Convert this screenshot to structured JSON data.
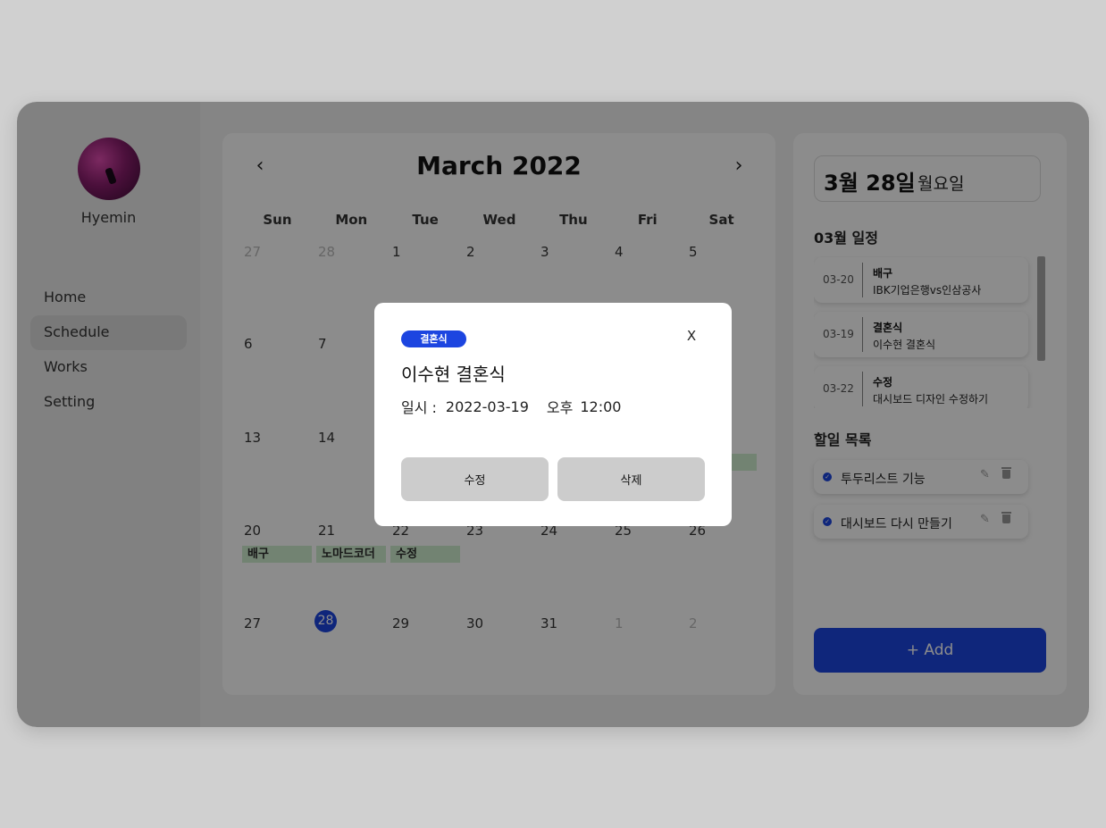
{
  "user": {
    "name": "Hyemin"
  },
  "nav": {
    "items": [
      "Home",
      "Schedule",
      "Works",
      "Setting"
    ],
    "active": "Schedule"
  },
  "calendar": {
    "title": "March 2022",
    "weekdays": [
      "Sun",
      "Mon",
      "Tue",
      "Wed",
      "Thu",
      "Fri",
      "Sat"
    ],
    "weeks": [
      [
        "27",
        "28",
        "1",
        "2",
        "3",
        "4",
        "5"
      ],
      [
        "6",
        "7",
        "",
        "",
        "",
        "",
        ""
      ],
      [
        "13",
        "14",
        "",
        "",
        "",
        "",
        ""
      ],
      [
        "20",
        "21",
        "22",
        "23",
        "24",
        "25",
        "26"
      ],
      [
        "27",
        "28",
        "29",
        "30",
        "31",
        "1",
        "2"
      ]
    ],
    "today": "28",
    "events": [
      {
        "label": "배구"
      },
      {
        "label": "노마드코더"
      },
      {
        "label": "수정"
      }
    ]
  },
  "sidebar_right": {
    "date_main": "3월 28일",
    "date_sub": "월요일",
    "schedule_title": "03월 일정",
    "schedules": [
      {
        "date": "03-20",
        "category": "배구",
        "desc": "IBK기업은행vs인삼공사"
      },
      {
        "date": "03-19",
        "category": "결혼식",
        "desc": "이수현 결혼식"
      },
      {
        "date": "03-22",
        "category": "수정",
        "desc": "대시보드 디자인 수정하기"
      }
    ],
    "todo_title": "할일 목록",
    "todos": [
      "투두리스트 기능",
      "대시보드 다시 만들기"
    ],
    "add_label": "+ Add"
  },
  "modal": {
    "tag": "결혼식",
    "close": "X",
    "title": "이수현 결혼식",
    "time_label": "일시 :",
    "date": "2022-03-19",
    "ampm": "오후",
    "time": "12:00",
    "edit_label": "수정",
    "delete_label": "삭제"
  },
  "colors": {
    "accent": "#1c45e0",
    "event": "#cfeecf"
  }
}
